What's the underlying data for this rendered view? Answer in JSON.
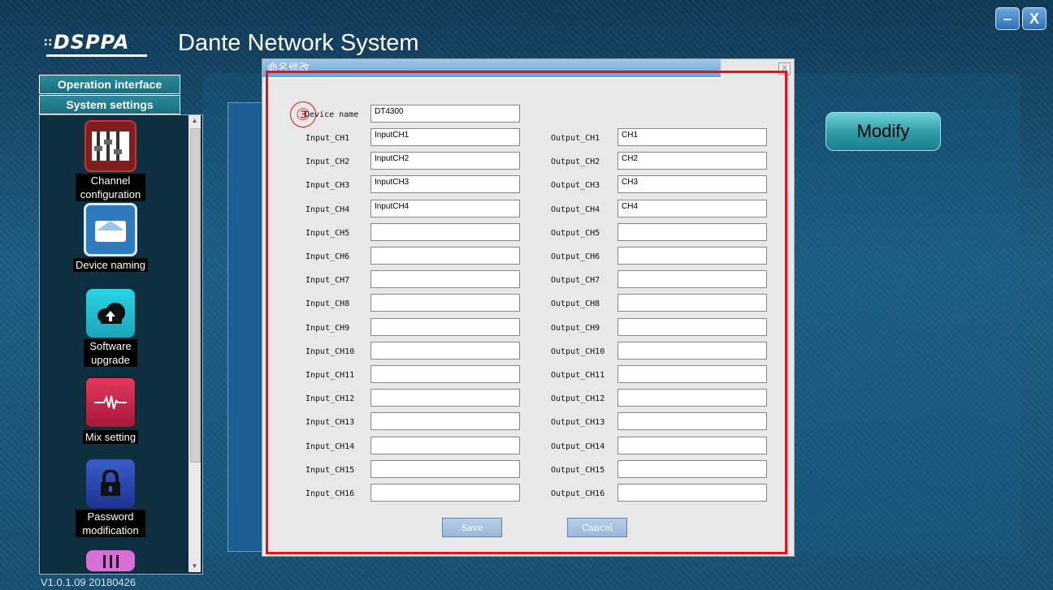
{
  "app": {
    "brand": "DSPPA",
    "dots": "∷",
    "title": "Dante Network System",
    "version": "V1.0.1.09  20180426"
  },
  "window": {
    "minimize": "–",
    "close": "X"
  },
  "sidebar": {
    "headers": [
      "Operation interface",
      "System settings"
    ],
    "items": [
      {
        "label": "Channel configuration",
        "icon": "channel-config-icon"
      },
      {
        "label": "Device naming",
        "icon": "device-naming-icon"
      },
      {
        "label": "Software upgrade",
        "icon": "cloud-upload-icon"
      },
      {
        "label": "Mix setting",
        "icon": "waveform-icon"
      },
      {
        "label": "Password modification",
        "icon": "lock-icon"
      }
    ],
    "scroll_up": "▲",
    "scroll_down": "▼"
  },
  "main": {
    "modify_label": "Modify"
  },
  "dialog": {
    "title": "命名修改",
    "close": "X",
    "step_marker": "③",
    "device_name_label": "Device name",
    "device_name_value": "DT4300",
    "inputs": [
      {
        "label": "Input_CH1",
        "value": "InputCH1"
      },
      {
        "label": "Input_CH2",
        "value": "InputCH2"
      },
      {
        "label": "Input_CH3",
        "value": "InputCH3"
      },
      {
        "label": "Input_CH4",
        "value": "InputCH4"
      },
      {
        "label": "Input_CH5",
        "value": ""
      },
      {
        "label": "Input_CH6",
        "value": ""
      },
      {
        "label": "Input_CH7",
        "value": ""
      },
      {
        "label": "Input_CH8",
        "value": ""
      },
      {
        "label": "Input_CH9",
        "value": ""
      },
      {
        "label": "Input_CH10",
        "value": ""
      },
      {
        "label": "Input_CH11",
        "value": ""
      },
      {
        "label": "Input_CH12",
        "value": ""
      },
      {
        "label": "Input_CH13",
        "value": ""
      },
      {
        "label": "Input_CH14",
        "value": ""
      },
      {
        "label": "Input_CH15",
        "value": ""
      },
      {
        "label": "Input_CH16",
        "value": ""
      }
    ],
    "outputs": [
      {
        "label": "Output_CH1",
        "value": "CH1"
      },
      {
        "label": "Output_CH2",
        "value": "CH2"
      },
      {
        "label": "Output_CH3",
        "value": "CH3"
      },
      {
        "label": "Output_CH4",
        "value": "CH4"
      },
      {
        "label": "Output_CH5",
        "value": ""
      },
      {
        "label": "Output_CH6",
        "value": ""
      },
      {
        "label": "Output_CH7",
        "value": ""
      },
      {
        "label": "Output_CH8",
        "value": ""
      },
      {
        "label": "Output_CH9",
        "value": ""
      },
      {
        "label": "Output_CH10",
        "value": ""
      },
      {
        "label": "Output_CH11",
        "value": ""
      },
      {
        "label": "Output_CH12",
        "value": ""
      },
      {
        "label": "Output_CH13",
        "value": ""
      },
      {
        "label": "Output_CH14",
        "value": ""
      },
      {
        "label": "Output_CH15",
        "value": ""
      },
      {
        "label": "Output_CH16",
        "value": ""
      }
    ],
    "save_label": "Save",
    "cancel_label": "Cancel"
  },
  "colors": {
    "highlight": "#e3131b",
    "accent": "#2e9aa7"
  }
}
